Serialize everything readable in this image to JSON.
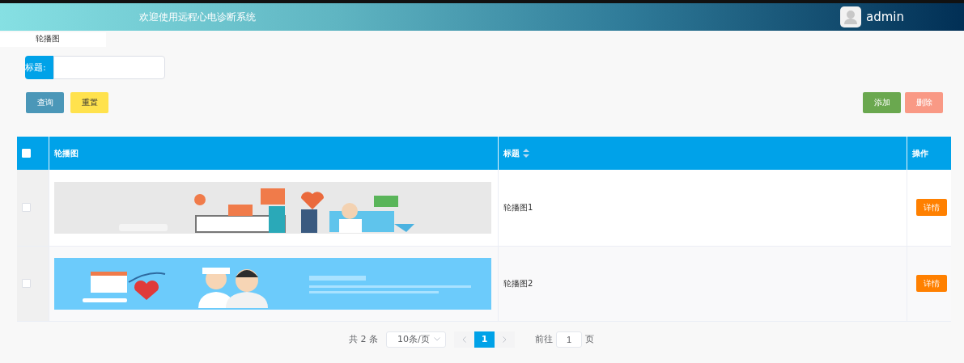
{
  "header": {
    "title": "欢迎使用远程心电诊断系统",
    "user": "admin"
  },
  "nav_tab": {
    "label": "轮播图"
  },
  "search": {
    "label": "标题:"
  },
  "buttons": [
    {
      "label": "查询",
      "kind": "query"
    },
    {
      "label": "重置",
      "kind": "reset"
    },
    {
      "label": "添加",
      "kind": "add"
    },
    {
      "label": "删除",
      "kind": "delete"
    }
  ],
  "table": {
    "select_all": {
      "checked": false
    },
    "columns": [
      {
        "label": "轮播图",
        "sortable": false
      },
      {
        "label": "标题",
        "sortable": true
      },
      {
        "label": "操作",
        "sortable": false
      }
    ],
    "rows": [
      {
        "checked": false,
        "title": "轮播图1",
        "action": "详情"
      },
      {
        "checked": false,
        "title": "轮播图2",
        "action": "详情"
      }
    ]
  },
  "pagination": {
    "total": "共 2 条",
    "page_size": "10条/页",
    "pages": [
      {
        "label": "1",
        "selected": true
      }
    ],
    "goto_label": "前往",
    "goto_value": "1",
    "goto_suffix": "页"
  }
}
